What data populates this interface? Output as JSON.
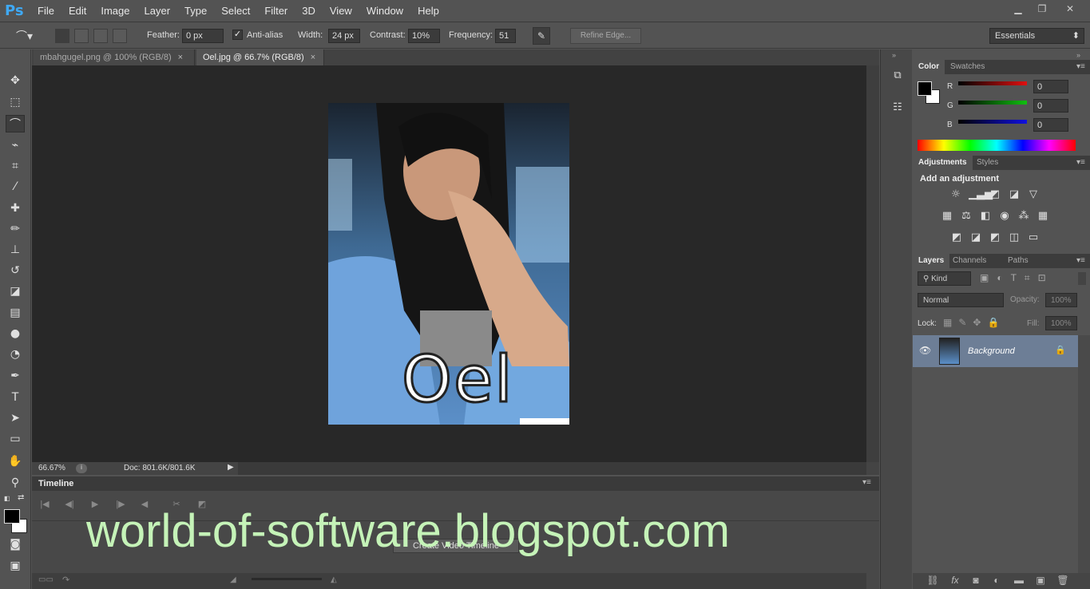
{
  "app": {
    "logo": "Ps"
  },
  "menu": [
    "File",
    "Edit",
    "Image",
    "Layer",
    "Type",
    "Select",
    "Filter",
    "3D",
    "View",
    "Window",
    "Help"
  ],
  "window_controls": {
    "minimize": "▁",
    "restore": "❐",
    "close": "✕"
  },
  "options": {
    "feather_label": "Feather:",
    "feather_value": "0 px",
    "antialias_label": "Anti-alias",
    "antialias_checked": "✓",
    "width_label": "Width:",
    "width_value": "24 px",
    "contrast_label": "Contrast:",
    "contrast_value": "10%",
    "frequency_label": "Frequency:",
    "frequency_value": "51",
    "refine_edge": "Refine Edge...",
    "workspace": "Essentials"
  },
  "tabs": [
    {
      "label": "mbahgugel.png @ 100% (RGB/8)",
      "close": "×"
    },
    {
      "label": "Oel.jpg @ 66.7% (RGB/8)",
      "close": "×"
    }
  ],
  "canvas": {
    "photo_text": "Oel"
  },
  "status": {
    "zoom": "66.67%",
    "doc": "Doc: 801.6K/801.6K"
  },
  "timeline": {
    "title": "Timeline",
    "create_button": "Create Video Timeline"
  },
  "watermark": "world-of-software.blogspot.com",
  "color_panel": {
    "tabs": [
      "Color",
      "Swatches"
    ],
    "channels": [
      {
        "label": "R",
        "value": "0",
        "color": "#e01010"
      },
      {
        "label": "G",
        "value": "0",
        "color": "#10c010"
      },
      {
        "label": "B",
        "value": "0",
        "color": "#1010e0"
      }
    ]
  },
  "adjustments_panel": {
    "tabs": [
      "Adjustments",
      "Styles"
    ],
    "heading": "Add an adjustment"
  },
  "layers_panel": {
    "tabs": [
      "Layers",
      "Channels",
      "Paths"
    ],
    "kind": "Kind",
    "blend_mode": "Normal",
    "opacity_label": "Opacity:",
    "opacity_value": "100%",
    "lock_label": "Lock:",
    "fill_label": "Fill:",
    "fill_value": "100%",
    "layer_name": "Background"
  },
  "colors": {
    "accent": "#3fa9f5",
    "selected_layer": "#6d7e96",
    "watermark": "#c5f3b8"
  }
}
